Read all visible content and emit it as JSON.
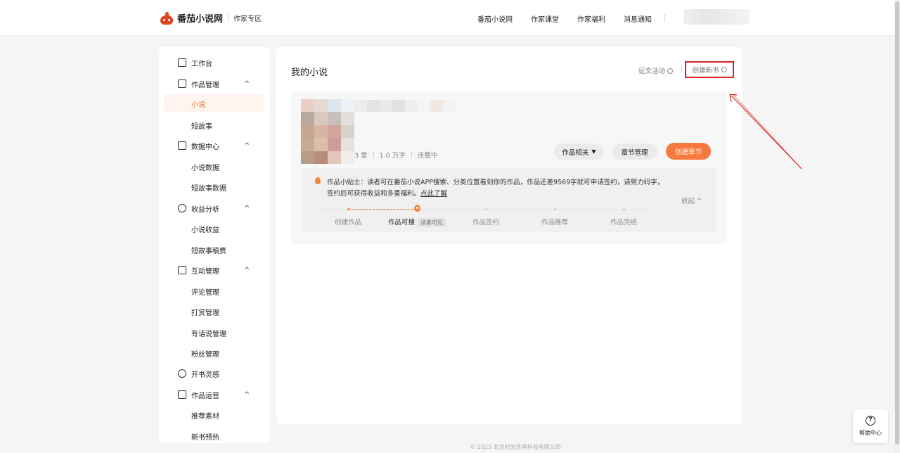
{
  "header": {
    "brand": "番茄小说网",
    "section": "作家专区",
    "nav": [
      "番茄小说网",
      "作家课堂",
      "作家福利",
      "消息通知"
    ]
  },
  "sidebar": {
    "items": [
      {
        "label": "工作台",
        "icon": "monitor-icon"
      },
      {
        "label": "作品管理",
        "icon": "book-icon"
      },
      {
        "label": "小说"
      },
      {
        "label": "短故事"
      },
      {
        "label": "数据中心",
        "icon": "chart-icon"
      },
      {
        "label": "小说数据"
      },
      {
        "label": "短故事数据"
      },
      {
        "label": "收益分析",
        "icon": "coin-icon"
      },
      {
        "label": "小说收益"
      },
      {
        "label": "短故事稿费"
      },
      {
        "label": "互动管理",
        "icon": "chat-icon"
      },
      {
        "label": "评论管理"
      },
      {
        "label": "打赏管理"
      },
      {
        "label": "有话说管理"
      },
      {
        "label": "粉丝管理"
      },
      {
        "label": "开书灵感",
        "icon": "bulb-icon"
      },
      {
        "label": "作品运营",
        "icon": "thumb-icon"
      },
      {
        "label": "推荐素材"
      },
      {
        "label": "新书预热"
      }
    ],
    "chevron": "^"
  },
  "main": {
    "title": "我的小说",
    "contest_link": "征文活动",
    "create_book": "创建新书",
    "book": {
      "chapters": "3 章",
      "words": "1.0 万字",
      "status": "连载中",
      "btn_related": "作品相关",
      "btn_chapters": "章节管理",
      "btn_create_chapter": "创建章节"
    },
    "tip": {
      "text": "作品小贴士：读者可在番茄小说APP搜索、分类位置看到你的作品，作品还差9569字就可申请签约，请努力码字，签约后可获得收益和多重福利。",
      "link": "点此了解",
      "collapse": "收起"
    },
    "steps": [
      {
        "label": "创建作品"
      },
      {
        "label": "作品可搜",
        "badge": "读者可见"
      },
      {
        "label": "作品签约"
      },
      {
        "label": "作品推荐"
      },
      {
        "label": "作品完结"
      }
    ]
  },
  "help": {
    "label": "帮助中心"
  },
  "footer": "© 2025 北京时光荏苒科技有限公司",
  "colors": {
    "accent": "#f77a3c",
    "annotation": "#e02020"
  }
}
